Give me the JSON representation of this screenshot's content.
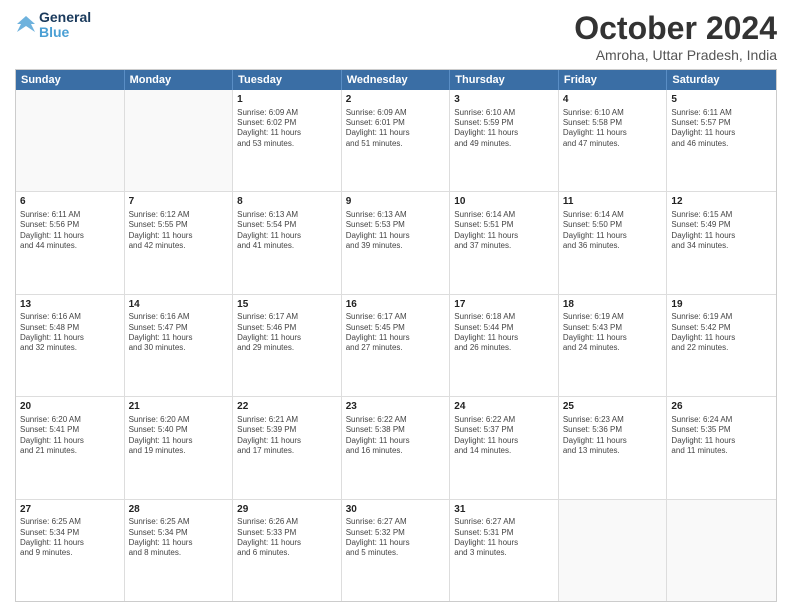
{
  "logo": {
    "general": "General",
    "blue": "Blue"
  },
  "title": "October 2024",
  "subtitle": "Amroha, Uttar Pradesh, India",
  "headers": [
    "Sunday",
    "Monday",
    "Tuesday",
    "Wednesday",
    "Thursday",
    "Friday",
    "Saturday"
  ],
  "rows": [
    [
      {
        "day": "",
        "lines": []
      },
      {
        "day": "",
        "lines": []
      },
      {
        "day": "1",
        "lines": [
          "Sunrise: 6:09 AM",
          "Sunset: 6:02 PM",
          "Daylight: 11 hours",
          "and 53 minutes."
        ]
      },
      {
        "day": "2",
        "lines": [
          "Sunrise: 6:09 AM",
          "Sunset: 6:01 PM",
          "Daylight: 11 hours",
          "and 51 minutes."
        ]
      },
      {
        "day": "3",
        "lines": [
          "Sunrise: 6:10 AM",
          "Sunset: 5:59 PM",
          "Daylight: 11 hours",
          "and 49 minutes."
        ]
      },
      {
        "day": "4",
        "lines": [
          "Sunrise: 6:10 AM",
          "Sunset: 5:58 PM",
          "Daylight: 11 hours",
          "and 47 minutes."
        ]
      },
      {
        "day": "5",
        "lines": [
          "Sunrise: 6:11 AM",
          "Sunset: 5:57 PM",
          "Daylight: 11 hours",
          "and 46 minutes."
        ]
      }
    ],
    [
      {
        "day": "6",
        "lines": [
          "Sunrise: 6:11 AM",
          "Sunset: 5:56 PM",
          "Daylight: 11 hours",
          "and 44 minutes."
        ]
      },
      {
        "day": "7",
        "lines": [
          "Sunrise: 6:12 AM",
          "Sunset: 5:55 PM",
          "Daylight: 11 hours",
          "and 42 minutes."
        ]
      },
      {
        "day": "8",
        "lines": [
          "Sunrise: 6:13 AM",
          "Sunset: 5:54 PM",
          "Daylight: 11 hours",
          "and 41 minutes."
        ]
      },
      {
        "day": "9",
        "lines": [
          "Sunrise: 6:13 AM",
          "Sunset: 5:53 PM",
          "Daylight: 11 hours",
          "and 39 minutes."
        ]
      },
      {
        "day": "10",
        "lines": [
          "Sunrise: 6:14 AM",
          "Sunset: 5:51 PM",
          "Daylight: 11 hours",
          "and 37 minutes."
        ]
      },
      {
        "day": "11",
        "lines": [
          "Sunrise: 6:14 AM",
          "Sunset: 5:50 PM",
          "Daylight: 11 hours",
          "and 36 minutes."
        ]
      },
      {
        "day": "12",
        "lines": [
          "Sunrise: 6:15 AM",
          "Sunset: 5:49 PM",
          "Daylight: 11 hours",
          "and 34 minutes."
        ]
      }
    ],
    [
      {
        "day": "13",
        "lines": [
          "Sunrise: 6:16 AM",
          "Sunset: 5:48 PM",
          "Daylight: 11 hours",
          "and 32 minutes."
        ]
      },
      {
        "day": "14",
        "lines": [
          "Sunrise: 6:16 AM",
          "Sunset: 5:47 PM",
          "Daylight: 11 hours",
          "and 30 minutes."
        ]
      },
      {
        "day": "15",
        "lines": [
          "Sunrise: 6:17 AM",
          "Sunset: 5:46 PM",
          "Daylight: 11 hours",
          "and 29 minutes."
        ]
      },
      {
        "day": "16",
        "lines": [
          "Sunrise: 6:17 AM",
          "Sunset: 5:45 PM",
          "Daylight: 11 hours",
          "and 27 minutes."
        ]
      },
      {
        "day": "17",
        "lines": [
          "Sunrise: 6:18 AM",
          "Sunset: 5:44 PM",
          "Daylight: 11 hours",
          "and 26 minutes."
        ]
      },
      {
        "day": "18",
        "lines": [
          "Sunrise: 6:19 AM",
          "Sunset: 5:43 PM",
          "Daylight: 11 hours",
          "and 24 minutes."
        ]
      },
      {
        "day": "19",
        "lines": [
          "Sunrise: 6:19 AM",
          "Sunset: 5:42 PM",
          "Daylight: 11 hours",
          "and 22 minutes."
        ]
      }
    ],
    [
      {
        "day": "20",
        "lines": [
          "Sunrise: 6:20 AM",
          "Sunset: 5:41 PM",
          "Daylight: 11 hours",
          "and 21 minutes."
        ]
      },
      {
        "day": "21",
        "lines": [
          "Sunrise: 6:20 AM",
          "Sunset: 5:40 PM",
          "Daylight: 11 hours",
          "and 19 minutes."
        ]
      },
      {
        "day": "22",
        "lines": [
          "Sunrise: 6:21 AM",
          "Sunset: 5:39 PM",
          "Daylight: 11 hours",
          "and 17 minutes."
        ]
      },
      {
        "day": "23",
        "lines": [
          "Sunrise: 6:22 AM",
          "Sunset: 5:38 PM",
          "Daylight: 11 hours",
          "and 16 minutes."
        ]
      },
      {
        "day": "24",
        "lines": [
          "Sunrise: 6:22 AM",
          "Sunset: 5:37 PM",
          "Daylight: 11 hours",
          "and 14 minutes."
        ]
      },
      {
        "day": "25",
        "lines": [
          "Sunrise: 6:23 AM",
          "Sunset: 5:36 PM",
          "Daylight: 11 hours",
          "and 13 minutes."
        ]
      },
      {
        "day": "26",
        "lines": [
          "Sunrise: 6:24 AM",
          "Sunset: 5:35 PM",
          "Daylight: 11 hours",
          "and 11 minutes."
        ]
      }
    ],
    [
      {
        "day": "27",
        "lines": [
          "Sunrise: 6:25 AM",
          "Sunset: 5:34 PM",
          "Daylight: 11 hours",
          "and 9 minutes."
        ]
      },
      {
        "day": "28",
        "lines": [
          "Sunrise: 6:25 AM",
          "Sunset: 5:34 PM",
          "Daylight: 11 hours",
          "and 8 minutes."
        ]
      },
      {
        "day": "29",
        "lines": [
          "Sunrise: 6:26 AM",
          "Sunset: 5:33 PM",
          "Daylight: 11 hours",
          "and 6 minutes."
        ]
      },
      {
        "day": "30",
        "lines": [
          "Sunrise: 6:27 AM",
          "Sunset: 5:32 PM",
          "Daylight: 11 hours",
          "and 5 minutes."
        ]
      },
      {
        "day": "31",
        "lines": [
          "Sunrise: 6:27 AM",
          "Sunset: 5:31 PM",
          "Daylight: 11 hours",
          "and 3 minutes."
        ]
      },
      {
        "day": "",
        "lines": []
      },
      {
        "day": "",
        "lines": []
      }
    ]
  ]
}
